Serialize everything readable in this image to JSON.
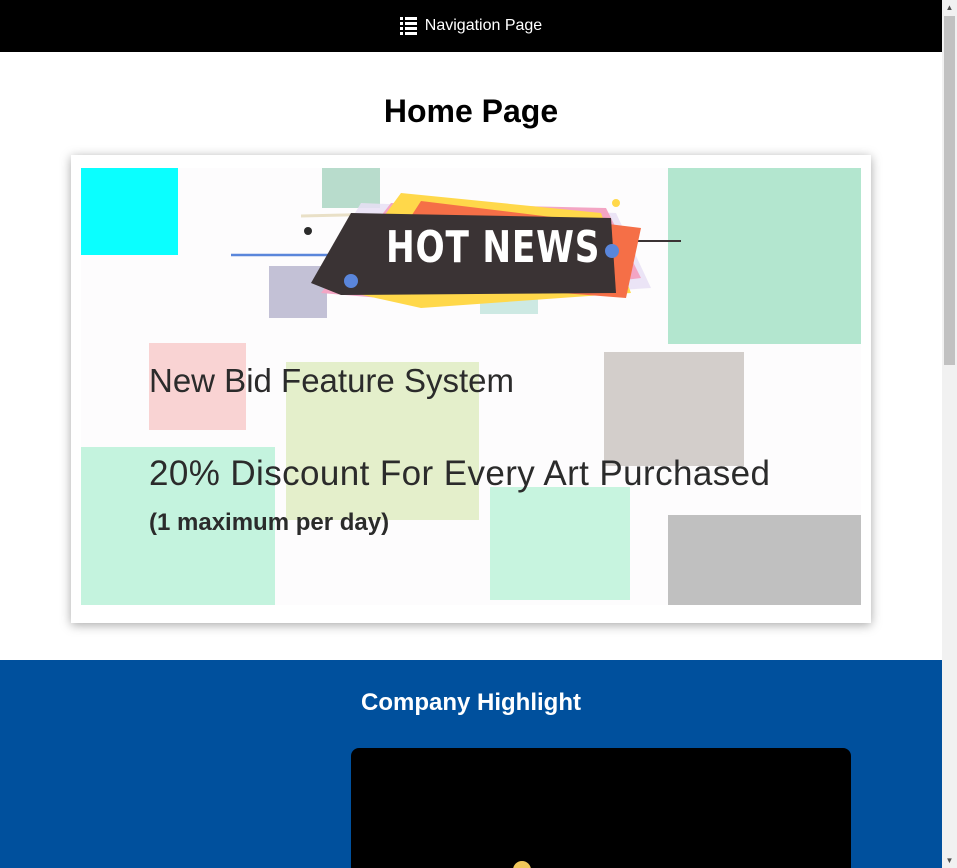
{
  "nav": {
    "icon": "list-icon",
    "label": "Navigation Page"
  },
  "page": {
    "title": "Home Page"
  },
  "banner": {
    "badge": "HOT NEWS",
    "headline_1": "New Bid Feature System",
    "headline_2": "20% Discount For Every Art Purchased",
    "headline_3": "(1 maximum per day)",
    "colors": {
      "cyan": "#0affff",
      "mint": "#b3e6cf",
      "pink": "#f9d3d3",
      "lime": "#e4efcb",
      "taupe": "#d3cecb",
      "grey": "#c0c0c0",
      "badge_dark": "#3a3334",
      "badge_orange": "#f56f47",
      "badge_yellow": "#ffd84a",
      "badge_pink": "#f3a5c4",
      "accent_blue": "#5a86db"
    }
  },
  "highlight": {
    "title": "Company Highlight",
    "background": "#00509d"
  },
  "scrollbar": {
    "up_icon": "chevron-up-icon",
    "down_icon": "chevron-down-icon"
  }
}
